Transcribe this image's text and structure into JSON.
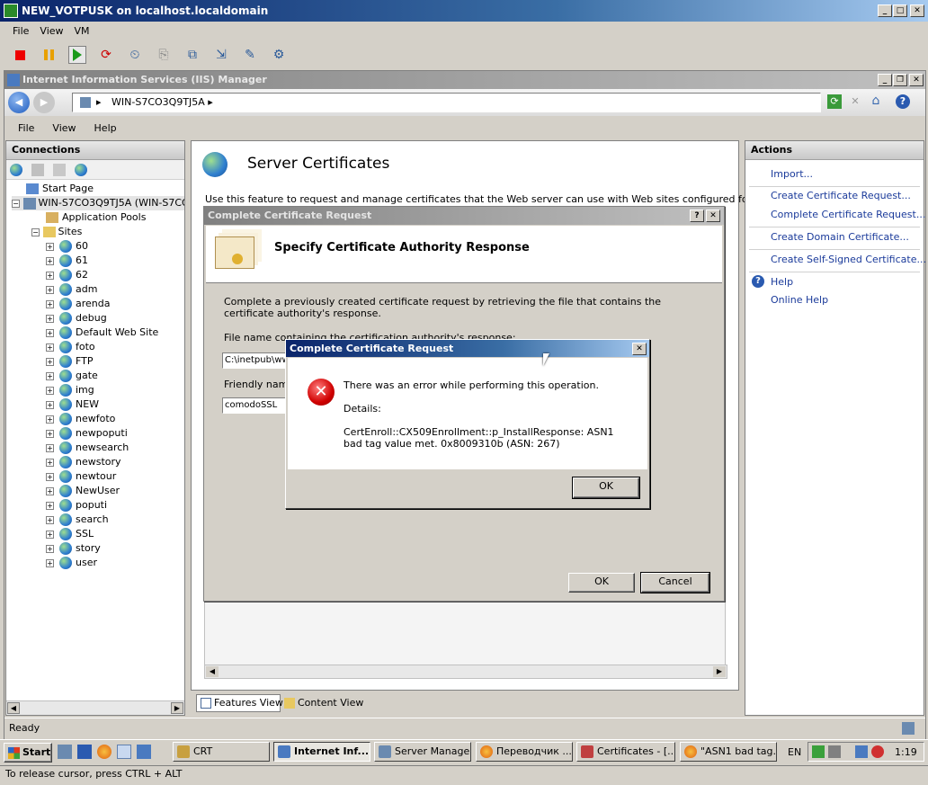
{
  "vm": {
    "title": "NEW_VOTPUSK on localhost.localdomain",
    "menu": [
      "File",
      "View",
      "VM"
    ],
    "status": "To release cursor, press CTRL + ALT"
  },
  "iis": {
    "title": "Internet Information Services (IIS) Manager",
    "address": "WIN-S7CO3Q9TJ5A",
    "menu": [
      "File",
      "View",
      "Help"
    ],
    "status": "Ready"
  },
  "connections": {
    "title": "Connections",
    "start_page": "Start Page",
    "server": "WIN-S7CO3Q9TJ5A (WIN-S7CO",
    "app_pools": "Application Pools",
    "sites": "Sites",
    "site_list": [
      "60",
      "61",
      "62",
      "adm",
      "arenda",
      "debug",
      "Default Web Site",
      "foto",
      "FTP",
      "gate",
      "img",
      "NEW",
      "newfoto",
      "newpoputi",
      "newsearch",
      "newstory",
      "newtour",
      "NewUser",
      "poputi",
      "search",
      "SSL",
      "story",
      "user"
    ]
  },
  "center": {
    "title": "Server Certificates",
    "description": "Use this feature to request and manage certificates that the Web server can use with Web sites configured for SSL.",
    "features_view": "Features View",
    "content_view": "Content View"
  },
  "actions": {
    "title": "Actions",
    "import": "Import...",
    "create_req": "Create Certificate Request...",
    "complete_req": "Complete Certificate Request...",
    "create_domain": "Create Domain Certificate...",
    "create_self": "Create Self-Signed Certificate...",
    "help": "Help",
    "online_help": "Online Help"
  },
  "wizard": {
    "title": "Complete Certificate Request",
    "heading": "Specify Certificate Authority Response",
    "intro": "Complete a previously created certificate request by retrieving the file that contains the certificate authority's response.",
    "file_label": "File name containing the certification authority's response:",
    "file_value": "C:\\inetpub\\ww",
    "friendly_label": "Friendly name",
    "friendly_value": "comodoSSL",
    "ok": "OK",
    "cancel": "Cancel"
  },
  "error": {
    "title": "Complete Certificate Request",
    "message": "There was an error while performing this operation.",
    "details_label": "Details:",
    "details": "CertEnroll::CX509Enrollment::p_InstallResponse: ASN1 bad tag value met. 0x8009310b (ASN: 267)",
    "ok": "OK"
  },
  "taskbar": {
    "start": "Start",
    "tasks": [
      "CRT",
      "Internet Inf...",
      "Server Manager",
      "Переводчик ...",
      "Certificates - [...",
      "\"ASN1 bad tag..."
    ],
    "lang": "EN",
    "time": "1:19"
  }
}
